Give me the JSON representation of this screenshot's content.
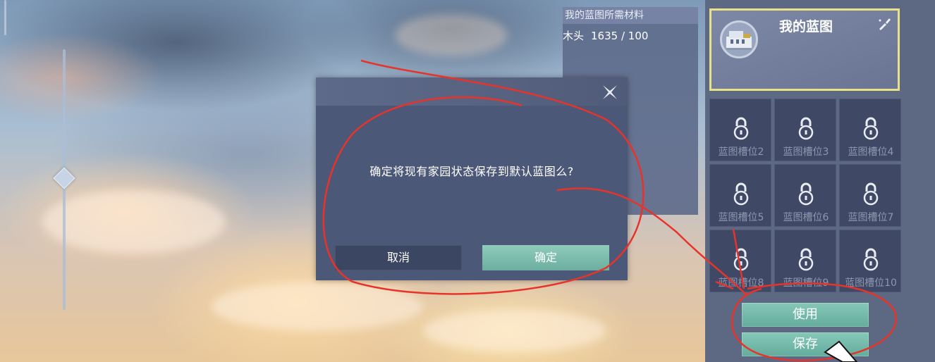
{
  "materials": {
    "title": "我的蓝图所需材料",
    "items": [
      {
        "name": "木头",
        "quantity": "1635 / 100"
      }
    ]
  },
  "my_blueprint": {
    "title": "我的蓝图",
    "icon": "house-blueprint-icon",
    "edit_icon": "brush-edit-icon"
  },
  "slots": [
    {
      "label": "蓝图槽位2",
      "icon": "lock-icon",
      "locked": true
    },
    {
      "label": "蓝图槽位3",
      "icon": "lock-icon",
      "locked": true
    },
    {
      "label": "蓝图槽位4",
      "icon": "lock-icon",
      "locked": true
    },
    {
      "label": "蓝图槽位5",
      "icon": "lock-icon",
      "locked": true
    },
    {
      "label": "蓝图槽位6",
      "icon": "lock-icon",
      "locked": true
    },
    {
      "label": "蓝图槽位7",
      "icon": "lock-icon",
      "locked": true
    },
    {
      "label": "蓝图槽位8",
      "icon": "lock-icon",
      "locked": true
    },
    {
      "label": "蓝图槽位9",
      "icon": "lock-icon",
      "locked": true
    },
    {
      "label": "蓝图槽位10",
      "icon": "lock-icon",
      "locked": true
    }
  ],
  "actions": {
    "use_label": "使用",
    "save_label": "保存"
  },
  "dialog": {
    "message": "确定将现有家园状态保存到默认蓝图么?",
    "cancel_label": "取消",
    "confirm_label": "确定",
    "close_icon": "close-icon"
  },
  "colors": {
    "accent_green": "#6cae9f",
    "highlight_border": "#e8e08a",
    "annotation_red": "#e8332a"
  }
}
